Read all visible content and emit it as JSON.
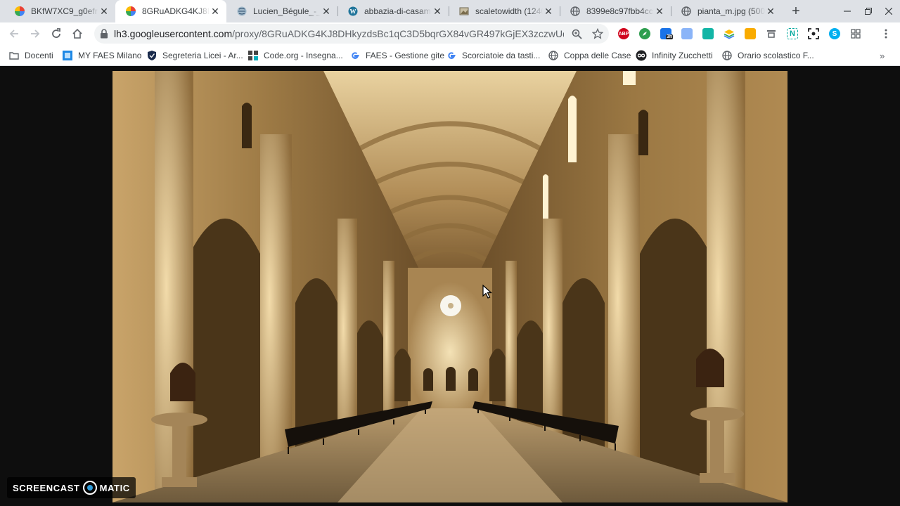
{
  "browser": {
    "tabs": [
      {
        "title": "BKfW7XC9_g0efr-2",
        "favicon": "photos-pinwheel-icon",
        "active": false
      },
      {
        "title": "8GRuADKG4KJ8DH",
        "favicon": "photos-pinwheel-icon",
        "active": true
      },
      {
        "title": "Lucien_Bégule_-_L'a",
        "favicon": "wikimedia-globe-icon",
        "active": false
      },
      {
        "title": "abbazia-di-casama",
        "favicon": "wordpress-icon",
        "active": false
      },
      {
        "title": "scaletowidth (1240",
        "favicon": "image-thumbnail-icon",
        "active": false
      },
      {
        "title": "8399e8c97fbb4cc2",
        "favicon": "globe-icon",
        "active": false
      },
      {
        "title": "pianta_m.jpg (500",
        "favicon": "globe-icon",
        "active": false
      }
    ],
    "address": {
      "host": "lh3.googleusercontent.com",
      "path": "/proxy/8GRuADKG4KJ8DHkyzdsBc1qC3D5bqrGX84vGR497kGjEX3zczwUqLlL..."
    },
    "extensions": [
      {
        "name": "adblock-plus-icon",
        "label": "ABP",
        "color": "#d0021b"
      },
      {
        "name": "compass-extension-icon",
        "label": "",
        "color": "#2e9e4f"
      },
      {
        "name": "screen-recorder-icon",
        "label": "3h",
        "color": "#1a73e8"
      },
      {
        "name": "image-tool-icon",
        "label": "",
        "color": "#8ab4f8"
      },
      {
        "name": "teal-extension-icon",
        "label": "",
        "color": "#12b5a6"
      },
      {
        "name": "layers-icon",
        "label": "",
        "color": "#34a853"
      },
      {
        "name": "keep-notes-icon",
        "label": "",
        "color": "#f9ab00"
      },
      {
        "name": "pen-tool-icon",
        "label": "",
        "color": "#5f6368"
      },
      {
        "name": "n-extension-icon",
        "label": "N",
        "color": "#00a89d"
      },
      {
        "name": "screenshot-icon",
        "label": "",
        "color": "#202124"
      },
      {
        "name": "skype-icon",
        "label": "S",
        "color": "#00aff0"
      },
      {
        "name": "extensions-puzzle-icon",
        "label": "",
        "color": "#5f6368"
      }
    ],
    "bookmarks": [
      {
        "label": "Docenti",
        "icon": "folder-icon"
      },
      {
        "label": "MY FAES Milano",
        "icon": "faes-logo-icon"
      },
      {
        "label": "Segreteria Licei - Ar...",
        "icon": "shield-icon"
      },
      {
        "label": "Code.org - Insegna...",
        "icon": "code-org-icon"
      },
      {
        "label": "FAES - Gestione gite",
        "icon": "google-icon"
      },
      {
        "label": "Scorciatoie da tasti...",
        "icon": "google-icon"
      },
      {
        "label": "Coppa delle Case",
        "icon": "globe-icon"
      },
      {
        "label": "Infinity Zucchetti",
        "icon": "infinity-icon"
      },
      {
        "label": "Orario scolastico F...",
        "icon": "globe-icon"
      }
    ]
  },
  "content": {
    "image_subject": "abbey-nave-photo"
  },
  "watermark": {
    "left": "SCREENCAST",
    "right": "MATIC"
  },
  "colors": {
    "tabstrip": "#dee1e6",
    "toolbar": "#ffffff",
    "page_background": "#0e0e0e",
    "stone_light": "#e8cf9a",
    "stone_dark": "#5a4122"
  }
}
